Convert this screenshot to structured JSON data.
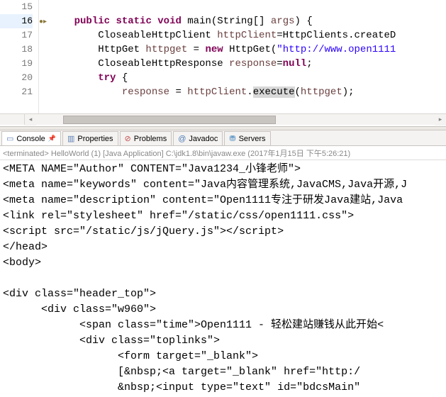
{
  "editor": {
    "lines": [
      {
        "num": "15",
        "html": ""
      },
      {
        "num": "16",
        "html": "    <span class='kw'>public</span> <span class='kw'>static</span> <span class='kw'>void</span> main(String[] <span class='var'>args</span>) {"
      },
      {
        "num": "17",
        "html": "        CloseableHttpClient <span class='var'>httpClient</span>=HttpClients.<span class='typ'>createD</span>"
      },
      {
        "num": "18",
        "html": "        HttpGet <span class='var'>httpget</span> = <span class='kw'>new</span> HttpGet(<span class='str'>\"http://www.open1111</span>"
      },
      {
        "num": "19",
        "html": "        CloseableHttpResponse <span class='var'>response</span>=<span class='kw'>null</span>;"
      },
      {
        "num": "20",
        "html": "        <span class='kw'>try</span> {"
      },
      {
        "num": "21",
        "html": "            <span class='var'>response</span> = <span class='var'>httpClient</span>.<span class='hl'>execute</span>(<span class='var'>httpget</span>);"
      }
    ],
    "current_line_idx": 1
  },
  "tabs": [
    {
      "icon_class": "icon-console",
      "icon": "▭",
      "label": "Console",
      "active": true,
      "pin": true
    },
    {
      "icon_class": "icon-props",
      "icon": "▥",
      "label": "Properties"
    },
    {
      "icon_class": "icon-prob",
      "icon": "⊘",
      "label": "Problems"
    },
    {
      "icon_class": "icon-java",
      "icon": "@",
      "label": "Javadoc"
    },
    {
      "icon_class": "icon-serv",
      "icon": "⛃",
      "label": "Servers"
    }
  ],
  "termination": {
    "status": "<terminated>",
    "name": "HelloWorld (1) [Java Application]",
    "path": "C:\\jdk1.8\\bin\\javaw.exe",
    "time": "(2017年1月15日 下午5:26:21)"
  },
  "console": {
    "lines": [
      "<META NAME=\"Author\" CONTENT=\"Java1234_小锋老师\">",
      "<meta name=\"keywords\" content=\"Java内容管理系统,JavaCMS,Java开源,J",
      "<meta name=\"description\" content=\"Open1111专注于研发Java建站,Java",
      "<link rel=\"stylesheet\" href=\"/static/css/open1111.css\">",
      "<script src=\"/static/js/jQuery.js\"></script>",
      "</head>",
      "<body>",
      "",
      "<div class=\"header_top\">",
      "      <div class=\"w960\">",
      "            <span class=\"time\">Open1111 - 轻松建站赚钱从此开始<",
      "            <div class=\"toplinks\">",
      "                  <form target=\"_blank\">",
      "                  [&nbsp;<a target=\"_blank\" href=\"http:/",
      "                  &nbsp;<input type=\"text\" id=\"bdcsMain\""
    ]
  }
}
